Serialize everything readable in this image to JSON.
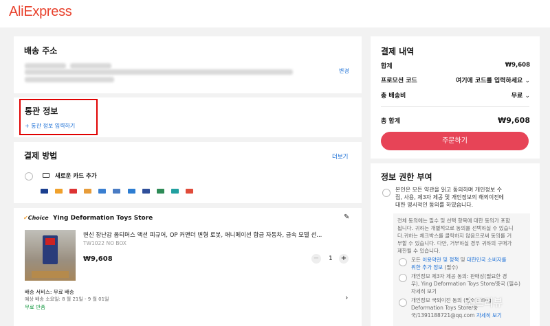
{
  "header": {
    "logo": "AliExpress"
  },
  "shipping": {
    "title": "배송 주소",
    "change_label": "변경"
  },
  "customs": {
    "title": "통관 정보",
    "add_label": "+ 통관 정보 입력하기"
  },
  "payment": {
    "title": "결제 방법",
    "more_label": "더보기",
    "new_card_label": "새로운 카드 추가",
    "card_icons": [
      "visa-icon",
      "mastercard-icon",
      "maestro-icon",
      "jcb-icon",
      "unionpay-icon",
      "diners-icon",
      "amex-icon",
      "discover-icon",
      "card-icon",
      "card-icon",
      "card-icon"
    ]
  },
  "product": {
    "choice_badge": "Choice",
    "store_name": "Ying Deformation Toys Store",
    "title": "변신 장난감 옵티머스 액션 피규어, OP 커맨더 변형 로봇, 애니메이션 합금 자동차, 금속 모델 선...",
    "sku": "TW1022 NO BOX",
    "price": "₩9,608",
    "quantity": "1",
    "shipping_service": "배송 서비스: 무료 배송",
    "delivery_estimate": "예상 배송 소요일: 8 월 21일 - 9 월 01일",
    "free_return": "무료 반품"
  },
  "summary": {
    "title": "결제 내역",
    "subtotal_label": "합계",
    "subtotal_value": "₩9,608",
    "promo_label": "프로모션 코드",
    "promo_value": "여기에 코드를 입력하세요",
    "shipping_label": "총 배송비",
    "shipping_value": "무료",
    "total_label": "총 합계",
    "total_value": "₩9,608",
    "order_button": "주문하기"
  },
  "consent": {
    "title": "정보 권한 부여",
    "main_text_1": "본인은 모든 약관을 읽고 동의하며 개인정보 수",
    "main_text_2": "집, 사용, 제3자 제공 및 개인정보의 해외이전에",
    "main_text_3": "대한 명시적인 동의를 하였습니다.",
    "info_1": "전체 동의에는 필수 및 선택 항목에 대한 동의가 포함",
    "info_2": "됩니다. 귀하는 개별적으로 동의를 선택하실 수 있습니",
    "info_3": "다.귀하는 체크박스를 클릭하지 않음으로써 동의를 거",
    "info_4": "부할 수 있습니다. 다만, 거부하실 경우 귀하의 구매가",
    "info_5": "제한될 수 있습니다.",
    "item1_a": "모든 ",
    "item1_link1": "이용약관 및 정책",
    "item1_b": " 및 ",
    "item1_link2": "대한민국 소비자를",
    "item1_link3": "위한 추가 정보",
    "item1_c": " (필수)",
    "item2_a": "개인정보 제3자 제공 동의: 판매상(필요한 경",
    "item2_b": "우), Ying Deformation Toys Store/중국 (필수)",
    "item2_link": "자세히 보기",
    "item3_a": "개인정보 국외이전 동의 (필수): Ying",
    "item3_b": "Deformation Toys Store/중",
    "item3_c": "국/1391188721@qq.com ",
    "item3_link": "자세히 보기"
  },
  "watermark": "소드리뷰",
  "colors": {
    "brand": "#e8412c",
    "order_button": "#e74457",
    "link": "#1b6fd6",
    "highlight_box": "#e00000"
  }
}
